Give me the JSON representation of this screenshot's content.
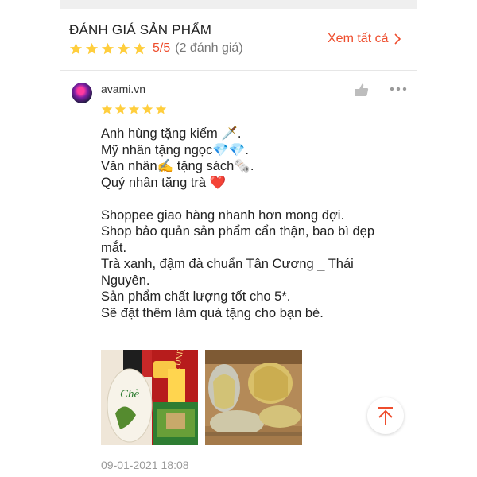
{
  "section": {
    "title": "ĐÁNH GIÁ SẢN PHẨM",
    "see_all": "Xem tất cả",
    "rating_score": "5/5",
    "rating_count": "(2 đánh giá)"
  },
  "review": {
    "username": "avami.vn",
    "stars": 5,
    "lines": [
      "Anh hùng tặng kiếm 🗡️.",
      "Mỹ nhân tặng ngọc💎💎.",
      "Văn nhân✍️ tặng sách🗞️.",
      "Quý nhân tặng trà ❤️",
      "",
      "Shoppee giao hàng nhanh hơn mong đợi.",
      "Shop bảo quản sản phẩm cẩn thận, bao bì đẹp mắt.",
      "Trà xanh, đậm đà chuẩn Tân Cương _ Thái Nguyên.",
      "Sản phẩm chất lượng tốt cho 5*.",
      "Sẽ đặt thêm làm quà tặng cho bạn bè."
    ],
    "photo_text": {
      "tea_label": "Chè",
      "brand": "R UNITE"
    },
    "timestamp": "09-01-2021 18:08"
  },
  "colors": {
    "accent": "#ee4d2d",
    "star": "#ffce3d",
    "muted": "#999999"
  },
  "icons": [
    "chevron-right-icon",
    "star-icon",
    "thumbs-up-icon",
    "more-icon",
    "arrow-up-icon"
  ]
}
